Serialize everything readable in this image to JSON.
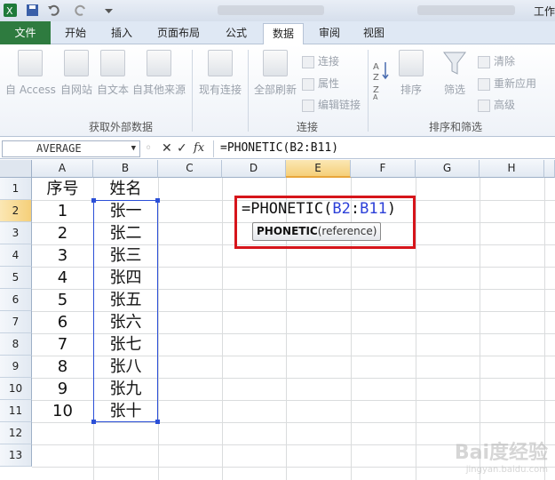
{
  "titlebar": {
    "title": "工作"
  },
  "tabs": [
    {
      "label": "文件"
    },
    {
      "label": "开始"
    },
    {
      "label": "插入"
    },
    {
      "label": "页面布局"
    },
    {
      "label": "公式"
    },
    {
      "label": "数据"
    },
    {
      "label": "审阅"
    },
    {
      "label": "视图"
    }
  ],
  "ribbon": {
    "get_external": {
      "access": "自 Access",
      "web": "自网站",
      "text": "自文本",
      "other": "自其他来源",
      "group_label": "获取外部数据"
    },
    "existing": "现有连接",
    "connections": {
      "refresh_all": "全部刷新",
      "connections": "连接",
      "properties": "属性",
      "edit_links": "编辑链接",
      "group_label": "连接"
    },
    "sort_filter": {
      "sort": "排序",
      "filter": "筛选",
      "clear": "清除",
      "reapply": "重新应用",
      "advanced": "高级",
      "group_label": "排序和筛选"
    }
  },
  "formula_bar": {
    "name_box": "AVERAGE",
    "formula": "=PHONETIC(B2:B11)"
  },
  "columns": [
    "A",
    "B",
    "C",
    "D",
    "E",
    "F",
    "G",
    "H"
  ],
  "rows": [
    "1",
    "2",
    "3",
    "4",
    "5",
    "6",
    "7",
    "8",
    "9",
    "10",
    "11",
    "12",
    "13"
  ],
  "cells": {
    "col_a": [
      "序号",
      "1",
      "2",
      "3",
      "4",
      "5",
      "6",
      "7",
      "8",
      "9",
      "10"
    ],
    "col_b": [
      "姓名",
      "张一",
      "张二",
      "张三",
      "张四",
      "张五",
      "张六",
      "张七",
      "张八",
      "张九",
      "张十"
    ]
  },
  "formula_cell": {
    "prefix": "=PHONETIC(",
    "ref_start": "B2",
    "colon": ":",
    "ref_end": "B11",
    "suffix": ")"
  },
  "tooltip": {
    "func": "PHONETIC",
    "args": "(reference)"
  },
  "watermark": {
    "brand": "Bai度经验",
    "url": "jingyan.baidu.com"
  }
}
